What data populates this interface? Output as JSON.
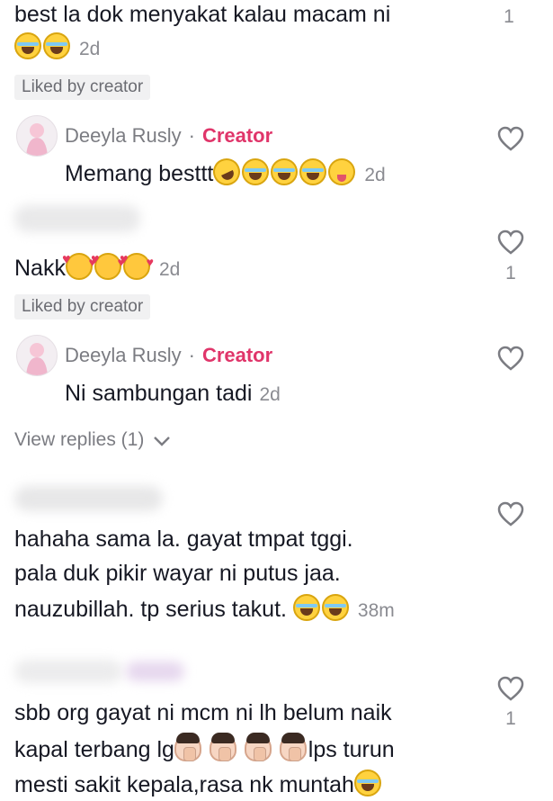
{
  "comments": [
    {
      "text": "best la dok menyakat kalau macam ni",
      "time": "2d",
      "likes": "1",
      "liked_badge": "Liked by creator",
      "emoji": [
        "laugh",
        "laugh"
      ]
    },
    {
      "author": "Deeyla Rusly",
      "separator": "·",
      "role": "Creator",
      "text": "Memang besttt",
      "time": "2d",
      "emoji": [
        "rofl",
        "laugh",
        "laugh",
        "laugh",
        "crazy"
      ]
    },
    {
      "text": "Nakk",
      "time": "2d",
      "likes": "1",
      "liked_badge": "Liked by creator",
      "emoji": [
        "love",
        "love",
        "love"
      ]
    },
    {
      "author": "Deeyla Rusly",
      "separator": "·",
      "role": "Creator",
      "text": "Ni sambungan tadi",
      "time": "2d"
    },
    {
      "view_replies": "View replies (1)"
    },
    {
      "lines": [
        "hahaha sama la. gayat tmpat tggi.",
        "pala duk pikir wayar ni putus jaa.",
        "nauzubillah. tp serius takut."
      ],
      "time": "38m",
      "emoji": [
        "laugh",
        "laugh"
      ]
    },
    {
      "lines": [
        "sbb org gayat ni mcm ni lh belum naik",
        "kapal terbang lg",
        "lps turun",
        "mesti sakit kepala,rasa nk muntah"
      ],
      "likes": "1",
      "emoji": [
        "facepalm",
        "facepalm",
        "facepalm",
        "facepalm",
        "laugh"
      ]
    }
  ],
  "icons": {
    "like": "heart-outline-icon",
    "expand": "chevron-down-icon"
  },
  "colors": {
    "creator": "#e0356a",
    "muted": "#8a8b91",
    "text": "#161823"
  }
}
